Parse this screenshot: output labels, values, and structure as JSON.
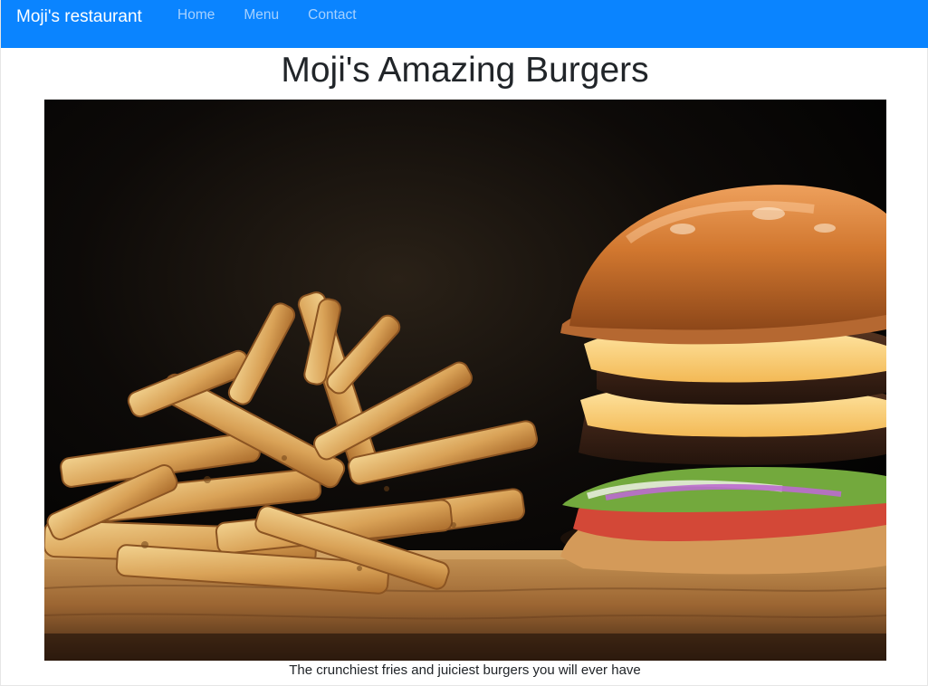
{
  "navbar": {
    "brand": "Moji's restaurant",
    "links": [
      {
        "label": "Home"
      },
      {
        "label": "Menu"
      },
      {
        "label": "Contact"
      }
    ],
    "background_color": "#0a84ff",
    "link_color": "#a6d1ff"
  },
  "main": {
    "title": "Moji's Amazing Burgers",
    "hero_image": {
      "subject": "burger-and-fries-photo"
    },
    "caption": "The crunchiest fries and juiciest burgers you will ever have"
  }
}
